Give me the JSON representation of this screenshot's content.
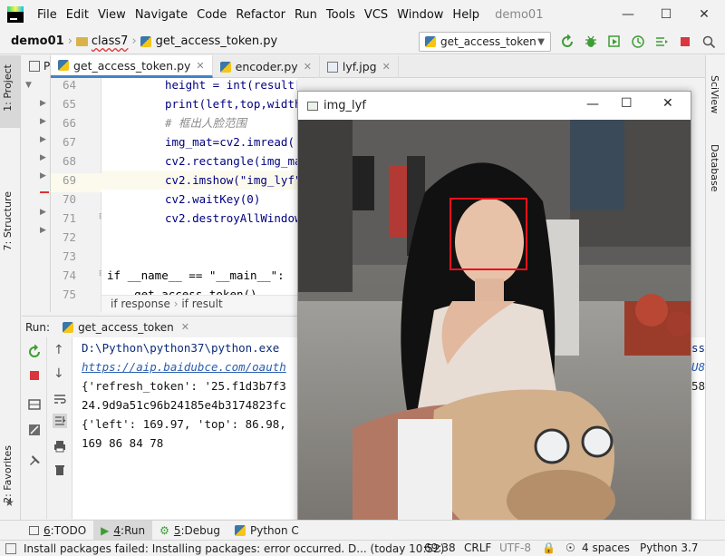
{
  "window": {
    "title": "demo01"
  },
  "menu": [
    "File",
    "Edit",
    "View",
    "Navigate",
    "Code",
    "Refactor",
    "Run",
    "Tools",
    "VCS",
    "Window",
    "Help"
  ],
  "nav": {
    "project": "demo01",
    "folder": "class7",
    "file": "get_access_token.py",
    "run_config": "get_access_token"
  },
  "side": {
    "project_tab": "1: Project",
    "structure_tab": "7: Structure",
    "favorites_tab": "2: Favorites",
    "sciview_tab": "SciView",
    "database_tab": "Database"
  },
  "tabs": [
    {
      "label": "get_access_token.py",
      "active": true
    },
    {
      "label": "encoder.py",
      "active": false
    },
    {
      "label": "lyf.jpg",
      "active": false
    }
  ],
  "project_stub": "P",
  "editor": {
    "lines": [
      {
        "num": "64",
        "code": "height = int(result['face_list'][0]['location']['height'])"
      },
      {
        "num": "65",
        "code": "print(left,top,width,height)"
      },
      {
        "num": "66",
        "code": "# 框出人脸范围"
      },
      {
        "num": "67",
        "code": "img_mat=cv2.imread('lyf.jpg')"
      },
      {
        "num": "68",
        "code": "cv2.rectangle(img_mat,(left,top),(left+width,top+height),(0,0,255),2)"
      },
      {
        "num": "69",
        "code": "cv2.imshow(\"img_lyf\",img_mat)"
      },
      {
        "num": "70",
        "code": "cv2.waitKey(0)"
      },
      {
        "num": "71",
        "code": "cv2.destroyAllWindows()"
      },
      {
        "num": "72",
        "code": ""
      },
      {
        "num": "73",
        "code": ""
      },
      {
        "num": "74",
        "code": "if __name__ == \"__main__\":"
      },
      {
        "num": "75",
        "code": "    get_access_token()"
      }
    ],
    "breadcrumb_1": "if response",
    "breadcrumb_2": "if result"
  },
  "run": {
    "label": "Run:",
    "tab": "get_access_token",
    "console": [
      "D:\\Python\\python37\\python.exe",
      "https://aip.baidubce.com/oauth",
      "{'refresh_token': '25.f1d3b7f3",
      "24.9d9a51c96b24185e4b3174823fc",
      "{'left': 169.97, 'top': 86.98,",
      "169 86 84 78"
    ],
    "console_right": [
      "ss",
      "U8",
      "58"
    ]
  },
  "image_window": {
    "title": "img_lyf",
    "face_box_color": "#e8101a"
  },
  "toolwindows": [
    {
      "num": "6",
      "label": "TODO"
    },
    {
      "num": "4",
      "label": "Run"
    },
    {
      "num": "5",
      "label": "Debug"
    },
    {
      "num": "",
      "label": "Python C"
    }
  ],
  "status": {
    "message": "Install packages failed: Installing packages: error occurred. D... (today 10:52)",
    "position": "69:38",
    "line_sep": "CRLF",
    "encoding": "UTF-8",
    "indent": "4 spaces",
    "interpreter": "Python 3.7"
  }
}
